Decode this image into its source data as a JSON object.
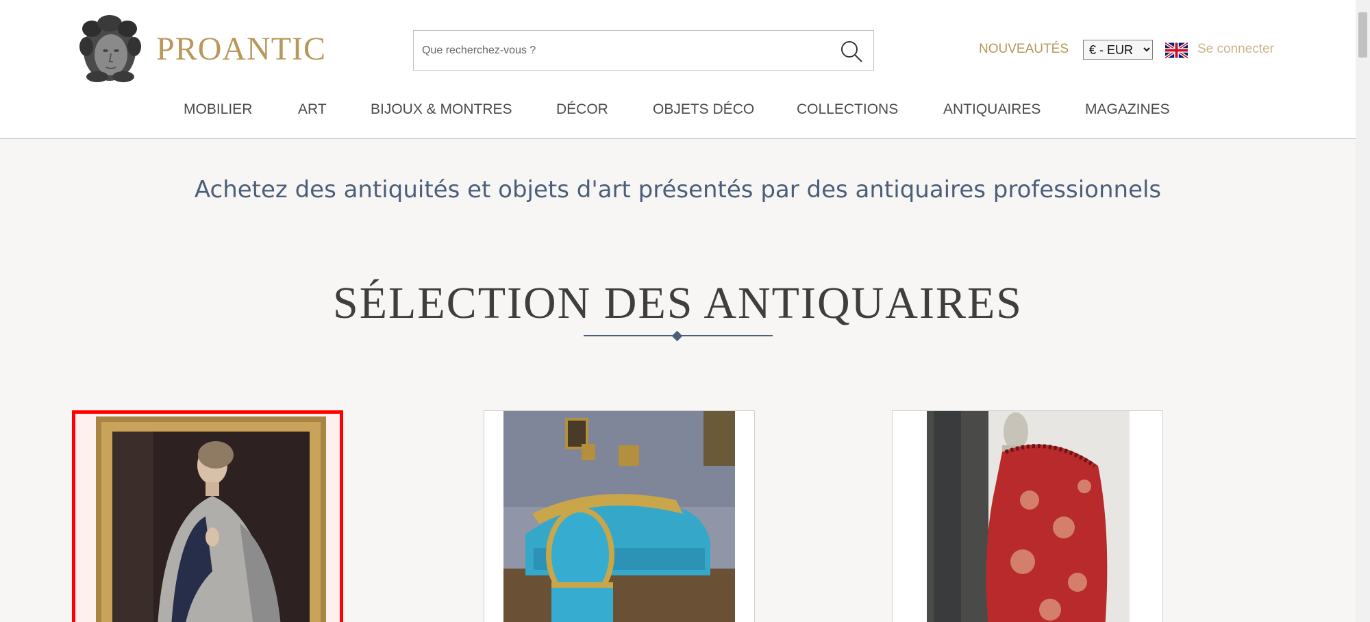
{
  "header": {
    "logo_text": "PROANTIC",
    "search_placeholder": "Que recherchez-vous ?",
    "search_icon": "search-icon",
    "new_label": "NOUVEAUTÉS",
    "currency_selected": "€ - EUR",
    "language_flag": "uk-flag-icon",
    "login_label": "Se connecter",
    "accent_color": "#b8975a"
  },
  "nav": {
    "items": [
      {
        "label": "MOBILIER"
      },
      {
        "label": "ART"
      },
      {
        "label": "BIJOUX & MONTRES"
      },
      {
        "label": "DÉCOR"
      },
      {
        "label": "OBJETS DÉCO"
      },
      {
        "label": "COLLECTIONS"
      },
      {
        "label": "ANTIQUAIRES"
      },
      {
        "label": "MAGAZINES"
      }
    ]
  },
  "main": {
    "tagline": "Achetez des antiquités et objets d'art présentés par des antiquaires professionnels",
    "section_title": "SÉLECTION DES ANTIQUAIRES",
    "cards": [
      {
        "name": "portrait-painting",
        "selected": true
      },
      {
        "name": "blue-sofa-set",
        "selected": false
      },
      {
        "name": "red-textile-drape",
        "selected": false
      }
    ]
  }
}
